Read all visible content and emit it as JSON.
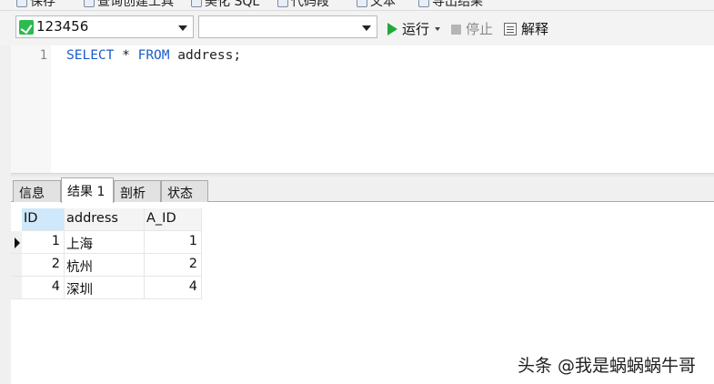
{
  "toolbar": {
    "items": [
      "保存",
      "查询创建工具",
      "美化 SQL",
      "代码段",
      "文本",
      "导出结果"
    ]
  },
  "connection": {
    "selected": "123456",
    "database_selected": ""
  },
  "actions": {
    "run_label": "运行",
    "stop_label": "停止",
    "explain_label": "解释"
  },
  "editor": {
    "line_number": "1",
    "sql": {
      "kw1": "SELECT",
      "star": " * ",
      "kw2": "FROM",
      "rest": " address;"
    }
  },
  "result_tabs": [
    "信息",
    "结果 1",
    "剖析",
    "状态"
  ],
  "active_tab": "结果 1",
  "grid": {
    "columns": [
      "ID",
      "address",
      "A_ID"
    ],
    "rows": [
      [
        "1",
        "上海",
        "1"
      ],
      [
        "2",
        "杭州",
        "2"
      ],
      [
        "4",
        "深圳",
        "4"
      ]
    ]
  },
  "watermark": "头条 @我是蜗蜗蜗牛哥",
  "colors": {
    "keyword": "#1a5cc8",
    "run_green": "#1faa3a",
    "header_selected": "#cfe8fb"
  }
}
